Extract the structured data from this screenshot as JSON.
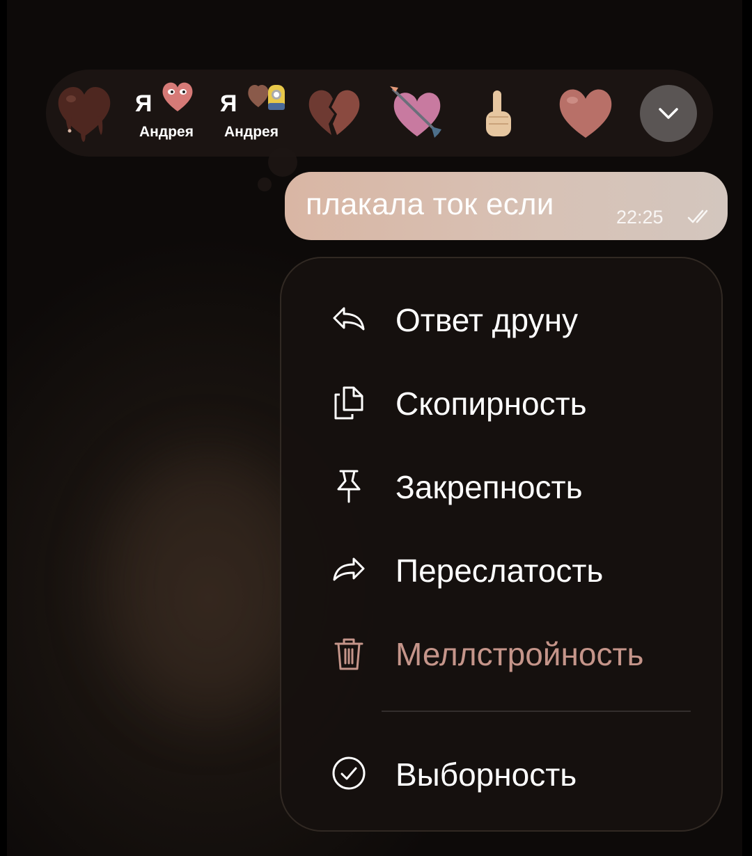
{
  "reactions": {
    "items": [
      {
        "name": "melting-heart",
        "color": "#5a2e24"
      },
      {
        "name": "ya-andreya-heart",
        "ya": "Я",
        "label": "Андрея",
        "color": "#d67a77"
      },
      {
        "name": "ya-andreya-minion",
        "ya": "Я",
        "label": "Андрея",
        "color": "#8a5a4a"
      },
      {
        "name": "broken-heart",
        "color": "#6e3a32"
      },
      {
        "name": "heart-arrow",
        "color": "#c87aa0"
      },
      {
        "name": "finger",
        "color": "#e6c6a0"
      },
      {
        "name": "heart",
        "color": "#b87068"
      }
    ],
    "more_icon": "chevron-down-icon"
  },
  "message": {
    "text": "плакала ток если",
    "time": "22:25",
    "status": "read",
    "bubble_color": "#d8bcae"
  },
  "menu": {
    "items": [
      {
        "id": "reply",
        "icon": "reply-icon",
        "label": "Ответ друну"
      },
      {
        "id": "copy",
        "icon": "copy-icon",
        "label": "Скопирность"
      },
      {
        "id": "pin",
        "icon": "pin-icon",
        "label": "Закрепность"
      },
      {
        "id": "forward",
        "icon": "forward-icon",
        "label": "Переслатость"
      },
      {
        "id": "delete",
        "icon": "trash-icon",
        "label": "Меллстройность",
        "danger": true
      }
    ],
    "select": {
      "id": "select",
      "icon": "check-circle-icon",
      "label": "Выборность"
    }
  },
  "colors": {
    "danger": "#c5958a",
    "menu_bg": "#16110f",
    "more_button": "#5a5554"
  }
}
